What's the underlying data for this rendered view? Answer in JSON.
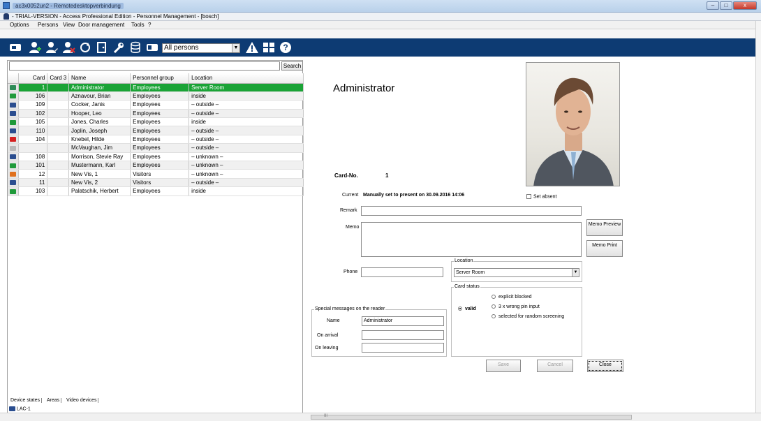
{
  "window": {
    "title": "ac3x0052un2 - Remotedesktopverbindung"
  },
  "app": {
    "title": "- TRIAL-VERSION - Access Professional Edition - Personnel Management - [bosch]"
  },
  "menu": {
    "items": [
      "Options",
      "Persons",
      "View",
      "Door management",
      "Tools",
      "?"
    ]
  },
  "toolbar": {
    "filter_value": "All persons"
  },
  "search": {
    "placeholder": "",
    "button": "Search"
  },
  "grid": {
    "columns": [
      "",
      "Card",
      "Card 3",
      "Name",
      "Personnel group",
      "Location"
    ],
    "rows": [
      {
        "card": "1",
        "card3": "",
        "name": "Administrator",
        "group": "Employees",
        "location": "Server Room",
        "icon_color": "#2e8b57",
        "selected": true
      },
      {
        "card": "106",
        "card3": "",
        "name": "Aznavour, Brian",
        "group": "Employees",
        "location": "inside",
        "icon_color": "#1f9a3a",
        "selected": false
      },
      {
        "card": "109",
        "card3": "",
        "name": "Cocker, Janis",
        "group": "Employees",
        "location": "– outside –",
        "icon_color": "#2a4d8f",
        "selected": false
      },
      {
        "card": "102",
        "card3": "",
        "name": "Hooper, Leo",
        "group": "Employees",
        "location": "– outside –",
        "icon_color": "#2a4d8f",
        "selected": false
      },
      {
        "card": "105",
        "card3": "",
        "name": "Jones, Charles",
        "group": "Employees",
        "location": "inside",
        "icon_color": "#1f9a3a",
        "selected": false
      },
      {
        "card": "110",
        "card3": "",
        "name": "Joplin, Joseph",
        "group": "Employees",
        "location": "– outside –",
        "icon_color": "#2a4d8f",
        "selected": false
      },
      {
        "card": "104",
        "card3": "",
        "name": "Knebel, Hilde",
        "group": "Employees",
        "location": "– outside –",
        "icon_color": "#d52020",
        "selected": false
      },
      {
        "card": "",
        "card3": "",
        "name": "McVaughan, Jim",
        "group": "Employees",
        "location": "– outside –",
        "icon_color": "#b8b8b8",
        "selected": false
      },
      {
        "card": "108",
        "card3": "",
        "name": "Morrison, Stevie Ray",
        "group": "Employees",
        "location": "– unknown –",
        "icon_color": "#2a4d8f",
        "selected": false
      },
      {
        "card": "101",
        "card3": "",
        "name": "Mustermann, Karl",
        "group": "Employees",
        "location": "– unknown –",
        "icon_color": "#1f9a3a",
        "selected": false
      },
      {
        "card": "12",
        "card3": "",
        "name": "New Vis, 1",
        "group": "Visitors",
        "location": "– unknown –",
        "icon_color": "#e0701c",
        "selected": false
      },
      {
        "card": "11",
        "card3": "",
        "name": "New Vis, 2",
        "group": "Visitors",
        "location": "– outside –",
        "icon_color": "#2a4d8f",
        "selected": false
      },
      {
        "card": "103",
        "card3": "",
        "name": "Palatschik, Herbert",
        "group": "Employees",
        "location": "inside",
        "icon_color": "#1f9a3a",
        "selected": false
      }
    ]
  },
  "bottom_tabs": [
    "Device states",
    "Areas",
    "Video devices"
  ],
  "device": {
    "name": "LAC-1"
  },
  "detail": {
    "name": "Administrator",
    "card_no_label": "Card-No.",
    "card_no": "1",
    "current_label": "Current",
    "current_value": "Manually set to present on 30.09.2016 14:06",
    "set_absent": "Set absent",
    "remark_label": "Remark",
    "remark_value": "",
    "memo_label": "Memo",
    "memo_value": "",
    "memo_preview": "Memo Preview",
    "memo_print": "Memo Print",
    "phone_label": "Phone",
    "phone_value": "",
    "location_caption": "Location",
    "location_value": "Server Room",
    "card_status_caption": "Card status",
    "status_valid": "valid",
    "status_blocked": "explicit blocked",
    "status_wrong_pin": "3 x wrong pin input",
    "status_random": "selected for random screening",
    "special_caption": "Special messages on the reader",
    "name_label": "Name",
    "name_value": "Administrator",
    "arrival_label": "On arrival",
    "arrival_value": "",
    "leaving_label": "On leaving",
    "leaving_value": "",
    "save": "Save",
    "cancel": "Cancel",
    "close": "Close"
  },
  "scrollbar": {
    "glyph": "III"
  }
}
